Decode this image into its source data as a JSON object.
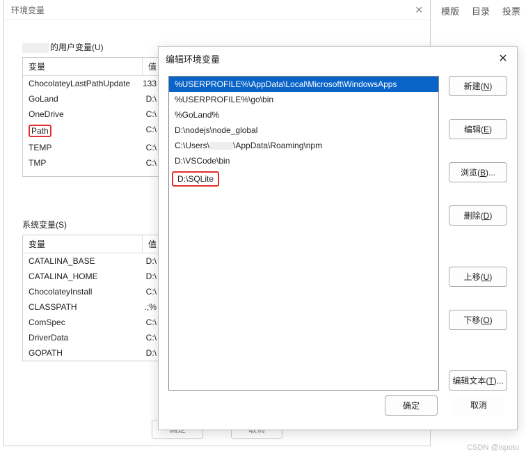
{
  "top_tabs": [
    "模版",
    "目录",
    "投票"
  ],
  "back": {
    "title": "环境变量",
    "user_label_suffix": "的用户变量(U)",
    "sys_label": "系统变量(S)",
    "cols": {
      "name": "变量",
      "value": "值"
    },
    "user_rows": [
      {
        "name": "ChocolateyLastPathUpdate",
        "value": "133",
        "hl": false
      },
      {
        "name": "GoLand",
        "value": "D:\\",
        "hl": false
      },
      {
        "name": "OneDrive",
        "value": "C:\\",
        "hl": false
      },
      {
        "name": "Path",
        "value": "C:\\",
        "hl": true
      },
      {
        "name": "TEMP",
        "value": "C:\\",
        "hl": false
      },
      {
        "name": "TMP",
        "value": "C:\\",
        "hl": false
      }
    ],
    "sys_rows": [
      {
        "name": "CATALINA_BASE",
        "value": "D:\\"
      },
      {
        "name": "CATALINA_HOME",
        "value": "D:\\"
      },
      {
        "name": "ChocolateyInstall",
        "value": "C:\\"
      },
      {
        "name": "CLASSPATH",
        "value": ".;%"
      },
      {
        "name": "ComSpec",
        "value": "C:\\"
      },
      {
        "name": "DriverData",
        "value": "C:\\"
      },
      {
        "name": "GOPATH",
        "value": "D:\\"
      }
    ],
    "btn_ok": "确定",
    "btn_cancel": "取消"
  },
  "dlg": {
    "title": "编辑环境变量",
    "items": [
      {
        "text": "%USERPROFILE%\\AppData\\Local\\Microsoft\\WindowsApps",
        "sel": true
      },
      {
        "text": "%USERPROFILE%\\go\\bin"
      },
      {
        "text": "%GoLand%"
      },
      {
        "text": "D:\\nodejs\\node_global"
      },
      {
        "text_pre": "C:\\Users\\",
        "text_post": "\\AppData\\Roaming\\npm",
        "censored": true
      },
      {
        "text": "D:\\VSCode\\bin"
      }
    ],
    "hl_item": "D:\\SQLite",
    "btns": {
      "new": "新建(N)",
      "edit": "编辑(E)",
      "browse": "浏览(B)...",
      "delete": "删除(D)",
      "up": "上移(U)",
      "down": "下移(O)",
      "edit_text": "编辑文本(T)...",
      "ok": "确定",
      "cancel": "取消"
    }
  },
  "watermark": "CSDN @ispotu"
}
